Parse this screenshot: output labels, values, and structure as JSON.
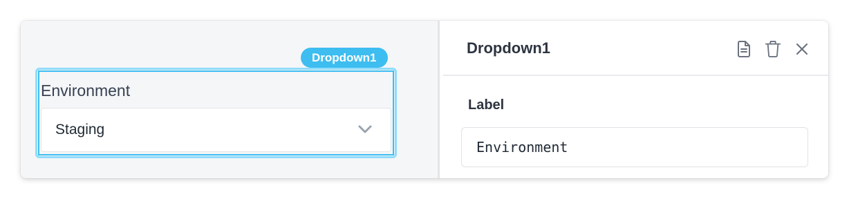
{
  "canvas": {
    "widget_name_tag": "Dropdown1",
    "dropdown": {
      "label": "Environment",
      "selected_value": "Staging"
    }
  },
  "inspector": {
    "title": "Dropdown1",
    "actions": {
      "docs_icon": "document-icon",
      "delete_icon": "trash-icon",
      "close_icon": "close-icon"
    },
    "fields": {
      "label_heading": "Label",
      "label_value": "Environment"
    }
  },
  "colors": {
    "accent": "#3dbdf0",
    "accent_light": "#8fdcfb",
    "canvas_bg": "#f5f6f8",
    "text_dark": "#2d3440",
    "icon_gray": "#6b7280"
  }
}
